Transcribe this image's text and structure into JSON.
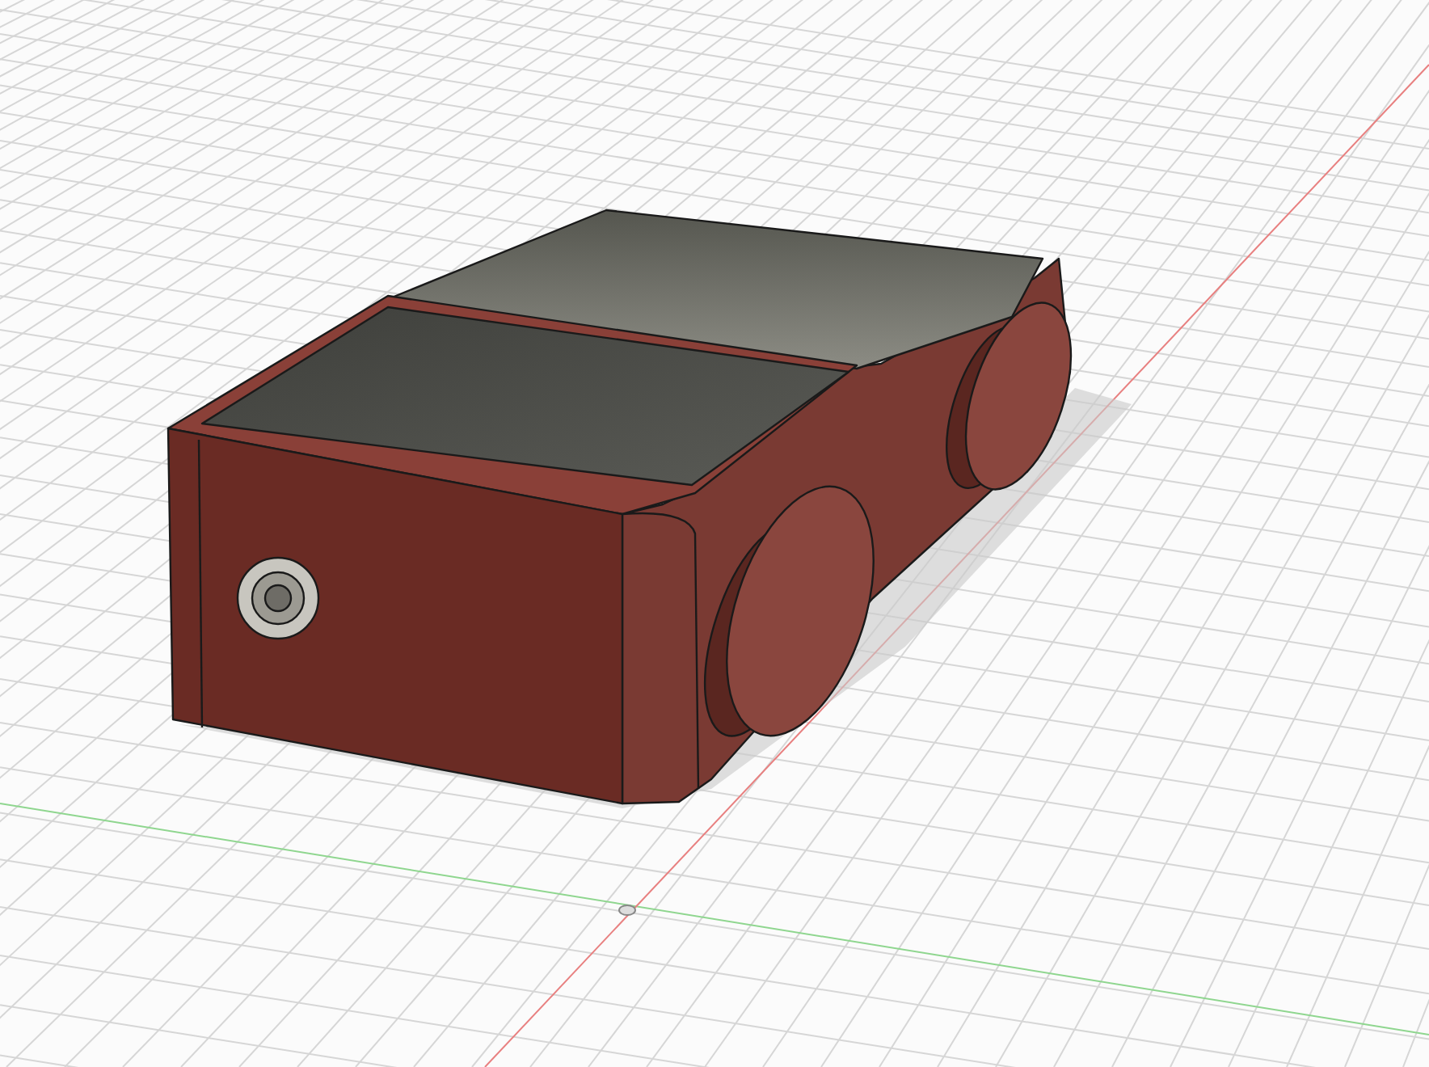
{
  "viewport": {
    "kind": "cad-3d"
  }
}
